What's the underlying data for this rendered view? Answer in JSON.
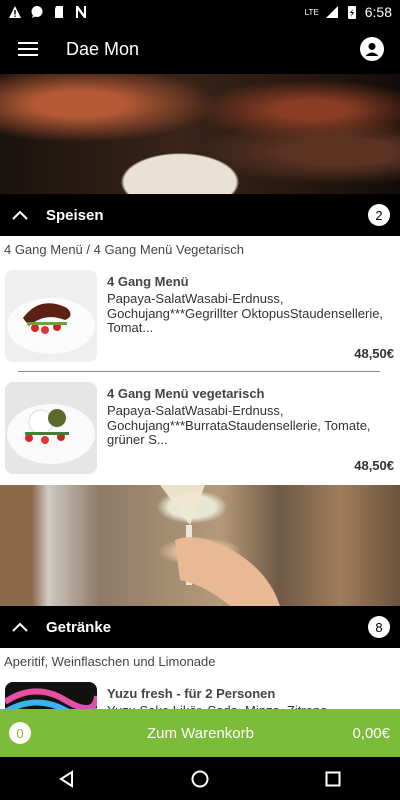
{
  "status": {
    "time": "6:58",
    "network": "LTE"
  },
  "appbar": {
    "title": "Dae Mon"
  },
  "sections": [
    {
      "title": "Speisen",
      "count": "2",
      "subtitle": "4 Gang Menü / 4 Gang Menü Vegetarisch",
      "items": [
        {
          "name": "4 Gang Menü",
          "description": "Papaya-SalatWasabi-Erdnuss, Gochujang***Gegrillter OktopusStaudensellerie, Tomat...",
          "price": "48,50€"
        },
        {
          "name": "4 Gang Menü vegetarisch",
          "description": "Papaya-SalatWasabi-Erdnuss, Gochujang***BurrataStaudensellerie, Tomate, grüner S...",
          "price": "48,50€"
        }
      ]
    },
    {
      "title": "Getränke",
      "count": "8",
      "subtitle": "Aperitif, Weinflaschen und Limonade",
      "items": [
        {
          "name": "Yuzu fresh - für 2 Personen",
          "description": "Yuzu Sake Likör, Soda, Minze, Zitrone..."
        }
      ]
    }
  ],
  "cart": {
    "count": "0",
    "label": "Zum Warenkorb",
    "total": "0,00€"
  },
  "icons": {
    "menu": "hamburger-menu-icon",
    "account": "account-icon",
    "collapse": "chevron-up-icon",
    "back": "nav-back-icon",
    "home": "nav-home-icon",
    "recents": "nav-recents-icon"
  },
  "colors": {
    "accent": "#7cbc3a",
    "bar": "#000000"
  }
}
